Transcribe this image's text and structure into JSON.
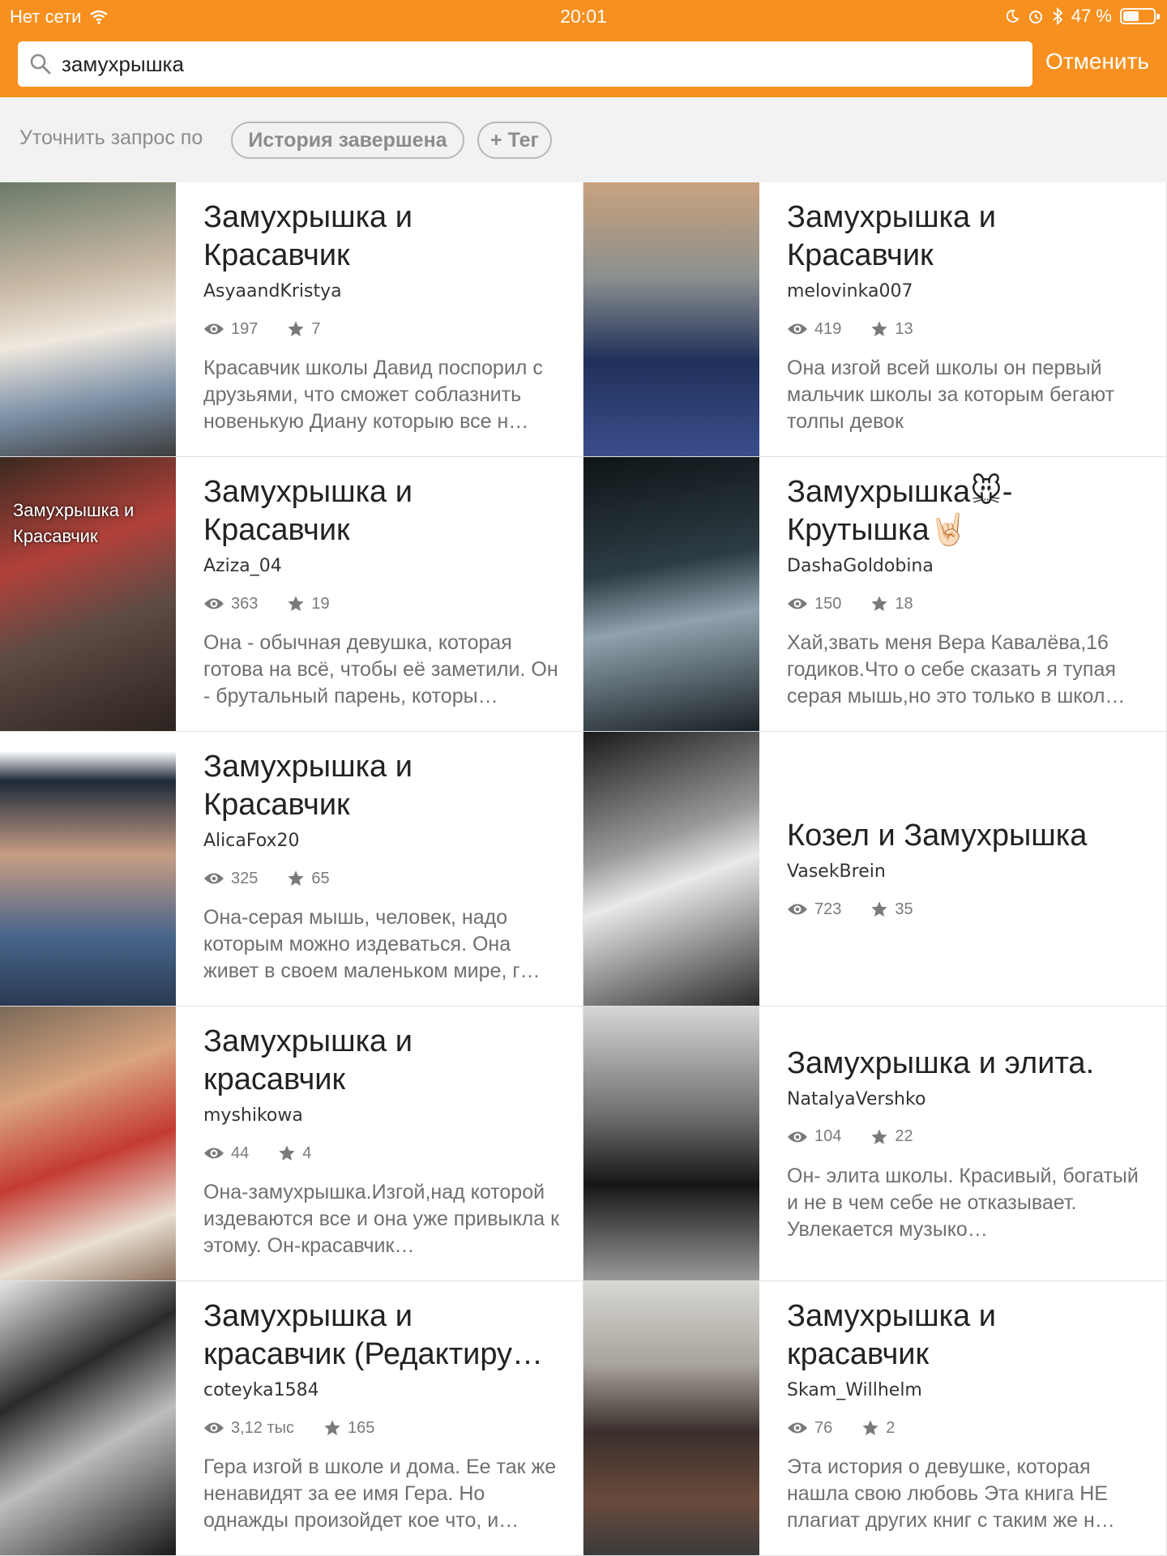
{
  "status_bar": {
    "network": "Нет сети",
    "time": "20:01",
    "battery": "47 %"
  },
  "search": {
    "query": "замухрышка",
    "cancel_label": "Отменить"
  },
  "filters": {
    "label": "Уточнить запрос по",
    "chips": [
      "История завершена",
      "+ Тег"
    ]
  },
  "results": [
    {
      "title": "Замухрышка и Красавчик",
      "author": "AsyaandKristya",
      "views": "197",
      "votes": "7",
      "description": "Красавчик школы Давид поспорил с друзьями, что сможет соблазнить новенькую Диану которыю все н…",
      "cover_text": ""
    },
    {
      "title": "Замухрышка и Красавчик",
      "author": "melovinka007",
      "views": "419",
      "votes": "13",
      "description": "Она изгой всей школы он первый мальчик школы за которым бегают толпы девок",
      "cover_text": ""
    },
    {
      "title": "Замухрышка и Красавчик",
      "author": "Aziza_04",
      "views": "363",
      "votes": "19",
      "description": "Она - обычная девушка, которая готова на всё, чтобы её заметили. Он - брутальный парень, которы…",
      "cover_text": "Замухрышка и Красавчик"
    },
    {
      "title": "Замухрышка🐭-Крутышка🤘🏻",
      "author": "DashaGoldobina",
      "views": "150",
      "votes": "18",
      "description": "Хай,звать меня Вера Кавалёва,16 годиков.Что о себе сказать я тупая серая мышь,но это только в школ…",
      "cover_text": ""
    },
    {
      "title": "Замухрышка и Красавчик",
      "author": "AlicaFox20",
      "views": "325",
      "votes": "65",
      "description": "Она-серая мышь, человек, надо которым можно издеваться. Она живет в своем маленьком мире, г…",
      "cover_text": ""
    },
    {
      "title": "Козел и Замухрышка",
      "author": "VasekBrein",
      "views": "723",
      "votes": "35",
      "description": "",
      "cover_text": ""
    },
    {
      "title": "Замухрышка и красавчик",
      "author": "myshikowa",
      "views": "44",
      "votes": "4",
      "description": "Она-замухрышка.Изгой,над которой издеваются все и она уже привыкла к этому. Он-красавчик…",
      "cover_text": ""
    },
    {
      "title": "Замухрышка и элита.",
      "author": "NatalyaVershko",
      "views": "104",
      "votes": "22",
      "description": "Он- элита школы. Красивый, богатый и не в чем себе не отказывает. Увлекается музыко…",
      "cover_text": ""
    },
    {
      "title": "Замухрышка и красавчик (Редактиру…",
      "author": "coteyka1584",
      "views": "3,12 тыс",
      "votes": "165",
      "description": "Гера изгой в школе и дома. Ее так же ненавидят за ее имя Гера. Но однажды произойдет кое что, и…",
      "cover_text": ""
    },
    {
      "title": "Замухрышка и красавчик",
      "author": "Skam_Willhelm",
      "views": "76",
      "votes": "2",
      "description": "Эта история о девушке, которая нашла свою любовь Эта книга НЕ плагиат других книг с таким же н…",
      "cover_text": ""
    }
  ]
}
